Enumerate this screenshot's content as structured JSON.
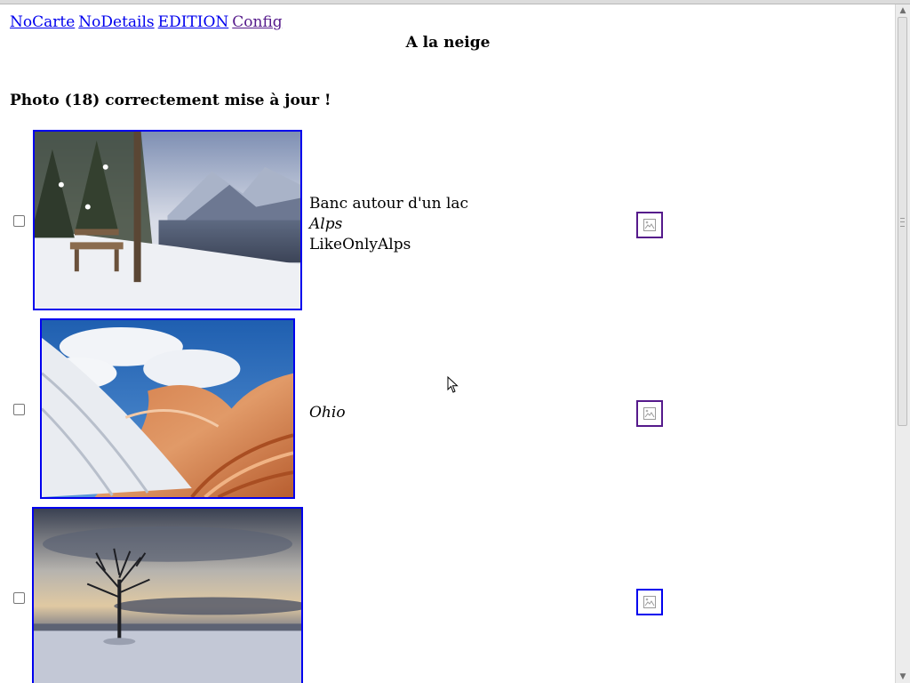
{
  "nav": {
    "links": [
      {
        "label": "NoCarte"
      },
      {
        "label": "NoDetails"
      },
      {
        "label": "EDITION"
      },
      {
        "label": "Config"
      }
    ]
  },
  "page": {
    "title": "A la neige",
    "status": "Photo (18) correctement mise à jour !"
  },
  "photos": [
    {
      "title": "Banc autour d'un lac",
      "location": "Alps",
      "source": "LikeOnlyAlps",
      "thumbnail_icon": "snowy-lake-bench-photo",
      "action_icon": "broken-image-icon"
    },
    {
      "title": "",
      "location": "Ohio",
      "source": "",
      "thumbnail_icon": "snowy-sandstone-wave-photo",
      "action_icon": "broken-image-icon"
    },
    {
      "title": "",
      "location": "",
      "source": "",
      "thumbnail_icon": "lone-winter-tree-photo",
      "action_icon": "broken-image-icon"
    }
  ],
  "colors": {
    "link": "#0000ee",
    "visited_link": "#551a8b"
  }
}
